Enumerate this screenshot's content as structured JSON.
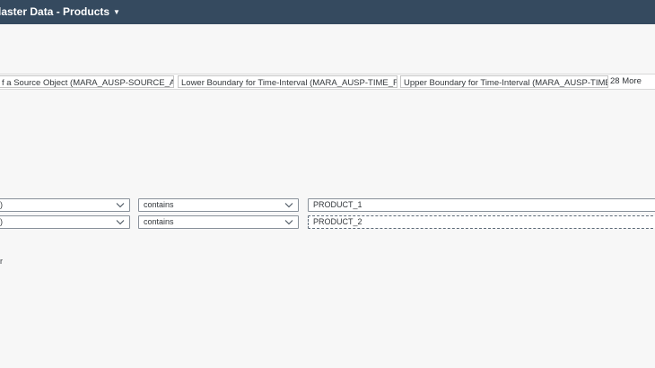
{
  "shell": {
    "title": "laster Data - Products"
  },
  "tokens": [
    {
      "label": "f a Source Object (MARA_AUSP-SOURCE_ATINN)"
    },
    {
      "label": "Lower Boundary for Time-Interval (MARA_AUSP-TIME_FROM)"
    },
    {
      "label": "Upper Boundary for Time-Interval (MARA_AUSP-TIME_TO)"
    }
  ],
  "tokens_more": "28 More",
  "conditions": [
    {
      "field_fragment": ")",
      "operator": "contains",
      "value": "PRODUCT_1"
    },
    {
      "field_fragment": ")",
      "operator": "contains",
      "value": "PRODUCT_2"
    }
  ],
  "left_fragment": "r",
  "icons": {
    "caret": "caret-down-icon",
    "remove": "remove-token-icon",
    "chevron": "chevron-down-icon"
  },
  "colors": {
    "shell": "#354a5f",
    "accent": "#0854a0",
    "background": "#f7f7f7"
  }
}
